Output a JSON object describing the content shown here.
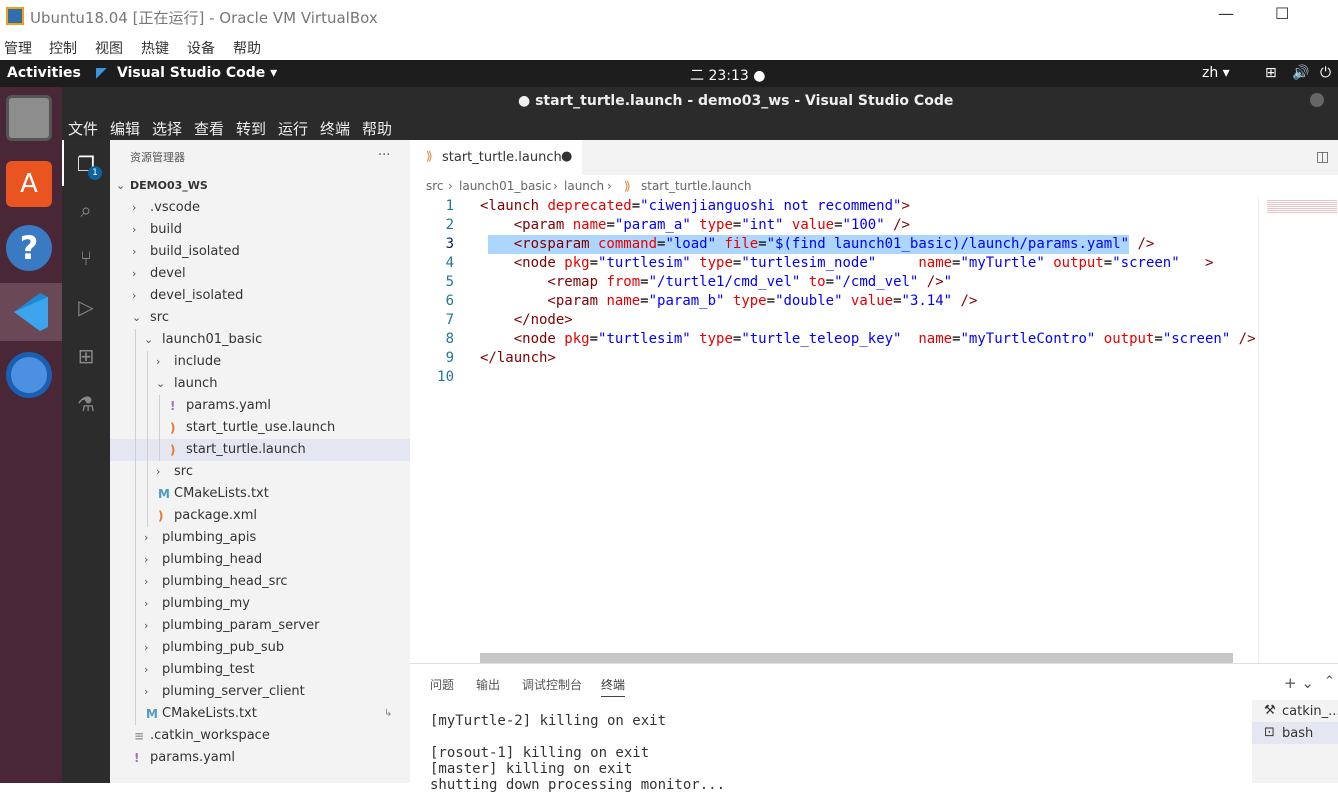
{
  "vbox": {
    "title": "Ubuntu18.04 [正在运行] - Oracle VM VirtualBox",
    "minimize": "—",
    "maximize": "☐",
    "menu": [
      "管理",
      "控制",
      "视图",
      "热键",
      "设备",
      "帮助"
    ]
  },
  "ubuntu": {
    "activities": "Activities",
    "app_name": "Visual Studio Code ▾",
    "clock": "二 23:13 ●",
    "lang": "zh ▾"
  },
  "vscode": {
    "title": "● start_turtle.launch - demo03_ws - Visual Studio Code",
    "menu": [
      "文件",
      "编辑",
      "选择",
      "查看",
      "转到",
      "运行",
      "终端",
      "帮助"
    ],
    "explorer_badge": "1",
    "sidebar": {
      "header": "资源管理器",
      "more": "···",
      "workspace": "DEMO03_WS",
      "items": [
        {
          "label": ".vscode",
          "indent": 1,
          "chev": "›"
        },
        {
          "label": "build",
          "indent": 1,
          "chev": "›"
        },
        {
          "label": "build_isolated",
          "indent": 1,
          "chev": "›"
        },
        {
          "label": "devel",
          "indent": 1,
          "chev": "›"
        },
        {
          "label": "devel_isolated",
          "indent": 1,
          "chev": "›"
        },
        {
          "label": "src",
          "indent": 1,
          "chev": "⌄"
        },
        {
          "label": "launch01_basic",
          "indent": 2,
          "chev": "⌄"
        },
        {
          "label": "include",
          "indent": 3,
          "chev": "›"
        },
        {
          "label": "launch",
          "indent": 3,
          "chev": "⌄"
        },
        {
          "label": "params.yaml",
          "indent": 4,
          "icon": "!",
          "iconColor": "#a074c4"
        },
        {
          "label": "start_turtle_use.launch",
          "indent": 4,
          "icon": ")",
          "iconColor": "#e37933"
        },
        {
          "label": "start_turtle.launch",
          "indent": 4,
          "icon": ")",
          "iconColor": "#e37933",
          "selected": true
        },
        {
          "label": "src",
          "indent": 3,
          "chev": "›"
        },
        {
          "label": "CMakeLists.txt",
          "indent": 3,
          "icon": "M",
          "iconColor": "#519aba"
        },
        {
          "label": "package.xml",
          "indent": 3,
          "icon": ")",
          "iconColor": "#e37933"
        },
        {
          "label": "plumbing_apis",
          "indent": 2,
          "chev": "›"
        },
        {
          "label": "plumbing_head",
          "indent": 2,
          "chev": "›"
        },
        {
          "label": "plumbing_head_src",
          "indent": 2,
          "chev": "›"
        },
        {
          "label": "plumbing_my",
          "indent": 2,
          "chev": "›"
        },
        {
          "label": "plumbing_param_server",
          "indent": 2,
          "chev": "›"
        },
        {
          "label": "plumbing_pub_sub",
          "indent": 2,
          "chev": "›"
        },
        {
          "label": "plumbing_test",
          "indent": 2,
          "chev": "›"
        },
        {
          "label": "pluming_server_client",
          "indent": 2,
          "chev": "›"
        },
        {
          "label": "CMakeLists.txt",
          "indent": 2,
          "icon": "M",
          "iconColor": "#519aba"
        },
        {
          "label": ".catkin_workspace",
          "indent": 1,
          "icon": "≡",
          "iconColor": "#999"
        },
        {
          "label": "params.yaml",
          "indent": 1,
          "icon": "!",
          "iconColor": "#a074c4"
        }
      ]
    },
    "tab": {
      "label": "start_turtle.launch",
      "dirty": "●"
    },
    "breadcrumbs": [
      "src",
      "›",
      "launch01_basic",
      "›",
      "launch",
      "›",
      "start_turtle.launch"
    ],
    "code_lines": [
      "1",
      "2",
      "3",
      "4",
      "5",
      "6",
      "7",
      "8",
      "9",
      "10"
    ],
    "panel_tabs": [
      "问题",
      "输出",
      "调试控制台",
      "终端"
    ],
    "terminal_lines": [
      "[myTurtle-2] killing on exit",
      "",
      "[rosout-1] killing on exit",
      "[master] killing on exit",
      "shutting down processing monitor..."
    ],
    "terminals": [
      "catkin_...",
      "bash"
    ]
  }
}
